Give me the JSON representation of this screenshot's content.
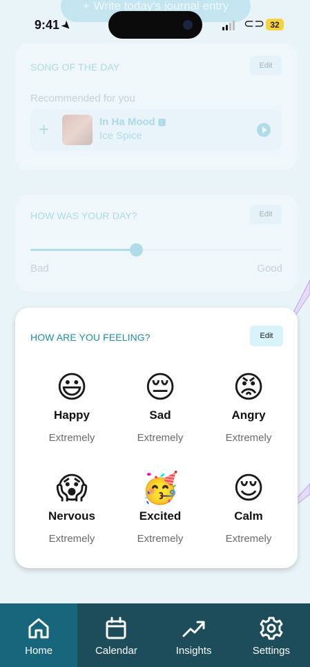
{
  "status_bar": {
    "time": "9:41",
    "battery": "32"
  },
  "journal_button": {
    "label": "Write today's journal entry"
  },
  "song_card": {
    "title": "SONG OF THE DAY",
    "edit_label": "Edit",
    "recommended_label": "Recommended for you",
    "song": {
      "title": "In Ha Mood",
      "artist": "Ice Spice"
    }
  },
  "day_card": {
    "title": "HOW WAS YOUR DAY?",
    "edit_label": "Edit",
    "slider_min": "Bad",
    "slider_max": "Good",
    "slider_value": 0.42
  },
  "feeling_card": {
    "title": "HOW ARE YOU FEELING?",
    "edit_label": "Edit",
    "emotions": [
      {
        "emoji": "😃",
        "name": "Happy",
        "level": "Extremely"
      },
      {
        "emoji": "😔",
        "name": "Sad",
        "level": "Extremely"
      },
      {
        "emoji": "😡",
        "name": "Angry",
        "level": "Extremely"
      },
      {
        "emoji": "😱",
        "name": "Nervous",
        "level": "Extremely"
      },
      {
        "emoji": "🥳",
        "name": "Excited",
        "level": "Extremely"
      },
      {
        "emoji": "😌",
        "name": "Calm",
        "level": "Extremely"
      }
    ]
  },
  "tabs": [
    {
      "label": "Home",
      "icon": "home-icon",
      "active": true
    },
    {
      "label": "Calendar",
      "icon": "calendar-icon",
      "active": false
    },
    {
      "label": "Insights",
      "icon": "trend-up-icon",
      "active": false
    },
    {
      "label": "Settings",
      "icon": "gear-icon",
      "active": false
    }
  ],
  "colors": {
    "accent": "#2aa3c4",
    "tab_bar": "#1d4c5a",
    "tab_active": "#17667b",
    "background": "#e9f4f9"
  }
}
